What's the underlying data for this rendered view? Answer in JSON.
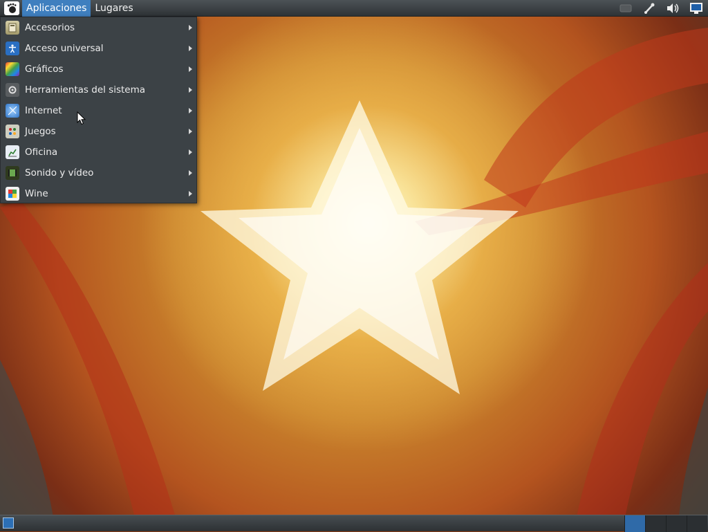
{
  "top_panel": {
    "menus": [
      {
        "label": "Aplicaciones",
        "active": true
      },
      {
        "label": "Lugares",
        "active": false
      }
    ],
    "tray_icons": [
      "mail-icon",
      "network-icon",
      "volume-icon",
      "display-icon"
    ]
  },
  "applications_menu": {
    "items": [
      {
        "label": "Accesorios",
        "icon": "accessories-icon"
      },
      {
        "label": "Acceso universal",
        "icon": "accessibility-icon"
      },
      {
        "label": "Gráficos",
        "icon": "graphics-icon"
      },
      {
        "label": "Herramientas del sistema",
        "icon": "system-tools-icon"
      },
      {
        "label": "Internet",
        "icon": "internet-icon"
      },
      {
        "label": "Juegos",
        "icon": "games-icon"
      },
      {
        "label": "Oficina",
        "icon": "office-icon"
      },
      {
        "label": "Sonido y vídeo",
        "icon": "multimedia-icon"
      },
      {
        "label": "Wine",
        "icon": "wine-icon"
      }
    ]
  },
  "bottom_panel": {
    "workspaces": 4,
    "active_workspace": 1
  },
  "colors": {
    "panel": "#3a3f43",
    "menu_background": "#3c4246",
    "highlight": "#3f7fbf"
  }
}
